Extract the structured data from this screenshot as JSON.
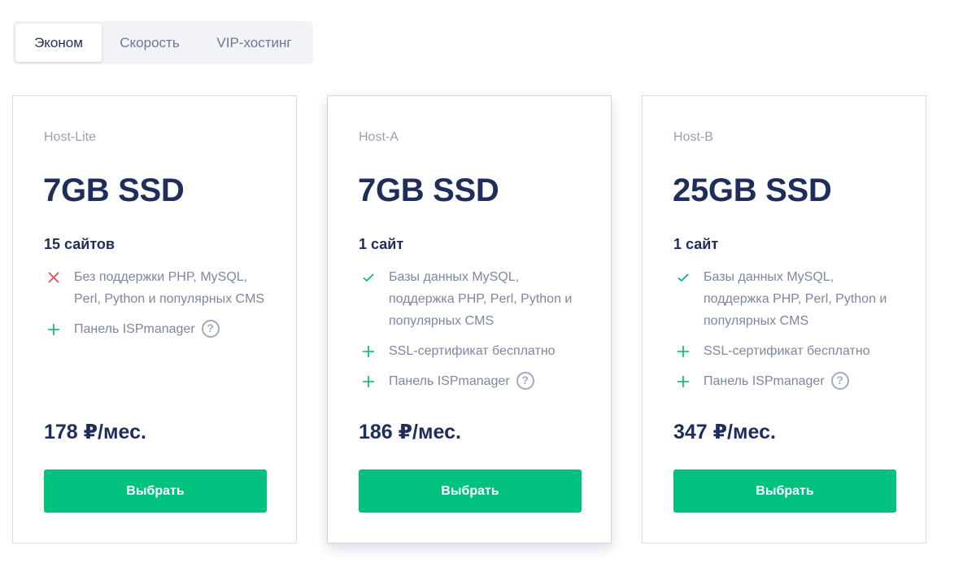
{
  "tabs": [
    {
      "label": "Эконом",
      "active": true
    },
    {
      "label": "Скорость",
      "active": false
    },
    {
      "label": "VIP-хостинг",
      "active": false
    }
  ],
  "colors": {
    "accent": "#00c27f",
    "heading": "#1f2d5a",
    "muted": "#7d879f",
    "cross": "#e8434f",
    "check": "#00b277"
  },
  "plans": [
    {
      "name": "Host-Lite",
      "storage": "7GB SSD",
      "sites": "15 сайтов",
      "features": [
        {
          "icon": "cross-icon",
          "text": "Без поддержки PHP, MySQL, Perl, Python и популярных CMS"
        },
        {
          "icon": "plus-icon",
          "text": "Панель ISPmanager",
          "help": true
        }
      ],
      "price": "178 ₽/мес.",
      "button": "Выбрать"
    },
    {
      "name": "Host-A",
      "storage": "7GB SSD",
      "sites": "1 сайт",
      "features": [
        {
          "icon": "check-icon",
          "text": "Базы данных MySQL, поддержка PHP, Perl, Python и популярных CMS"
        },
        {
          "icon": "plus-icon",
          "text": "SSL-сертификат бесплатно"
        },
        {
          "icon": "plus-icon",
          "text": "Панель ISPmanager",
          "help": true
        }
      ],
      "price": "186 ₽/мес.",
      "button": "Выбрать"
    },
    {
      "name": "Host-B",
      "storage": "25GB SSD",
      "sites": "1 сайт",
      "features": [
        {
          "icon": "check-icon",
          "text": "Базы данных MySQL, поддержка PHP, Perl, Python и популярных CMS"
        },
        {
          "icon": "plus-icon",
          "text": "SSL-сертификат бесплатно"
        },
        {
          "icon": "plus-icon",
          "text": "Панель ISPmanager",
          "help": true
        }
      ],
      "price": "347 ₽/мес.",
      "button": "Выбрать"
    }
  ]
}
